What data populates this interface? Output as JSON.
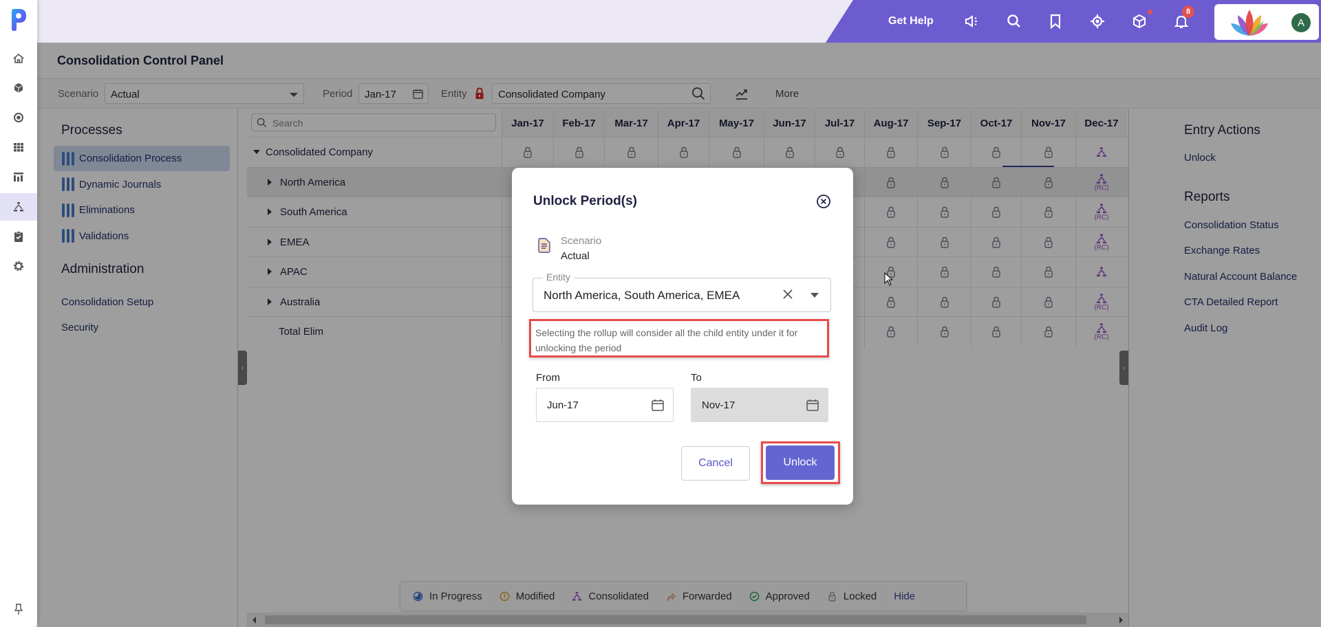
{
  "header": {
    "get_help": "Get Help",
    "notification_count": "8",
    "avatar_initial": "A",
    "icons": [
      "announcement-icon",
      "search-icon",
      "bookmark-icon",
      "target-icon",
      "cube-icon",
      "bell-icon"
    ]
  },
  "rail": {
    "icons": [
      "home-icon",
      "cube-icon",
      "target-icon",
      "grid-icon",
      "report-icon",
      "hierarchy-icon",
      "clipboard-check-icon",
      "gear-icon"
    ],
    "active": "hierarchy-icon",
    "pin_icon": "pin-icon"
  },
  "page": {
    "title": "Consolidation Control Panel"
  },
  "toolbar": {
    "scenario_label": "Scenario",
    "scenario_value": "Actual",
    "period_label": "Period",
    "period_value": "Jan-17",
    "entity_label": "Entity",
    "entity_value": "Consolidated Company",
    "more_label": "More"
  },
  "left_panel": {
    "processes_heading": "Processes",
    "processes": [
      {
        "label": "Consolidation Process",
        "active": true
      },
      {
        "label": "Dynamic Journals",
        "active": false
      },
      {
        "label": "Eliminations",
        "active": false
      },
      {
        "label": "Validations",
        "active": false
      }
    ],
    "administration_heading": "Administration",
    "admin_links": [
      "Consolidation Setup",
      "Security"
    ]
  },
  "grid": {
    "search_placeholder": "Search",
    "columns": [
      "Jan-17",
      "Feb-17",
      "Mar-17",
      "Apr-17",
      "May-17",
      "Jun-17",
      "Jul-17",
      "Aug-17",
      "Sep-17",
      "Oct-17",
      "Nov-17",
      "Dec-17"
    ],
    "rows": [
      {
        "name": "Consolidated Company",
        "expanded": true,
        "level": 0,
        "dec_status": "consolidated",
        "dec_rc": ""
      },
      {
        "name": "North America",
        "expanded": false,
        "level": 1,
        "dec_status": "consolidated",
        "dec_rc": "(RC)"
      },
      {
        "name": "South America",
        "expanded": false,
        "level": 1,
        "dec_status": "consolidated",
        "dec_rc": "(RC)"
      },
      {
        "name": "EMEA",
        "expanded": false,
        "level": 1,
        "dec_status": "consolidated",
        "dec_rc": "(RC)"
      },
      {
        "name": "APAC",
        "expanded": false,
        "level": 1,
        "dec_status": "consolidated",
        "dec_rc": ""
      },
      {
        "name": "Australia",
        "expanded": false,
        "level": 1,
        "dec_status": "consolidated",
        "dec_rc": "(RC)"
      },
      {
        "name": "Total Elim",
        "expanded": null,
        "level": 1,
        "dec_status": "consolidated",
        "dec_rc": "(RC)"
      }
    ],
    "default_status": "locked"
  },
  "legend": {
    "items": [
      {
        "label": "In Progress",
        "icon": "in-progress-icon",
        "color": "#2f6fc9"
      },
      {
        "label": "Modified",
        "icon": "modified-icon",
        "color": "#e29b21"
      },
      {
        "label": "Consolidated",
        "icon": "consolidated-icon",
        "color": "#9b4fc4"
      },
      {
        "label": "Forwarded",
        "icon": "forwarded-icon",
        "color": "#d9a58c"
      },
      {
        "label": "Approved",
        "icon": "approved-icon",
        "color": "#1e9a57"
      },
      {
        "label": "Locked",
        "icon": "locked-icon",
        "color": "#8a8aa0"
      }
    ],
    "hide_label": "Hide"
  },
  "right_panel": {
    "entry_actions_heading": "Entry Actions",
    "entry_actions": [
      "Unlock"
    ],
    "reports_heading": "Reports",
    "reports": [
      "Consolidation Status",
      "Exchange Rates",
      "Natural Account Balance",
      "CTA Detailed Report",
      "Audit Log"
    ]
  },
  "modal": {
    "title": "Unlock Period(s)",
    "scenario_label": "Scenario",
    "scenario_value": "Actual",
    "entity_label": "Entity",
    "entity_value": "North America, South America, EMEA",
    "note": "Selecting the rollup will consider all the child entity under it for unlocking the period",
    "from_label": "From",
    "from_value": "Jun-17",
    "to_label": "To",
    "to_value": "Nov-17",
    "cancel_label": "Cancel",
    "unlock_label": "Unlock"
  },
  "colors": {
    "brand_purple": "#6c5ccf",
    "primary_button": "#6366d1",
    "highlight_red": "#e84a4a",
    "consolidated": "#9b4fc4"
  }
}
